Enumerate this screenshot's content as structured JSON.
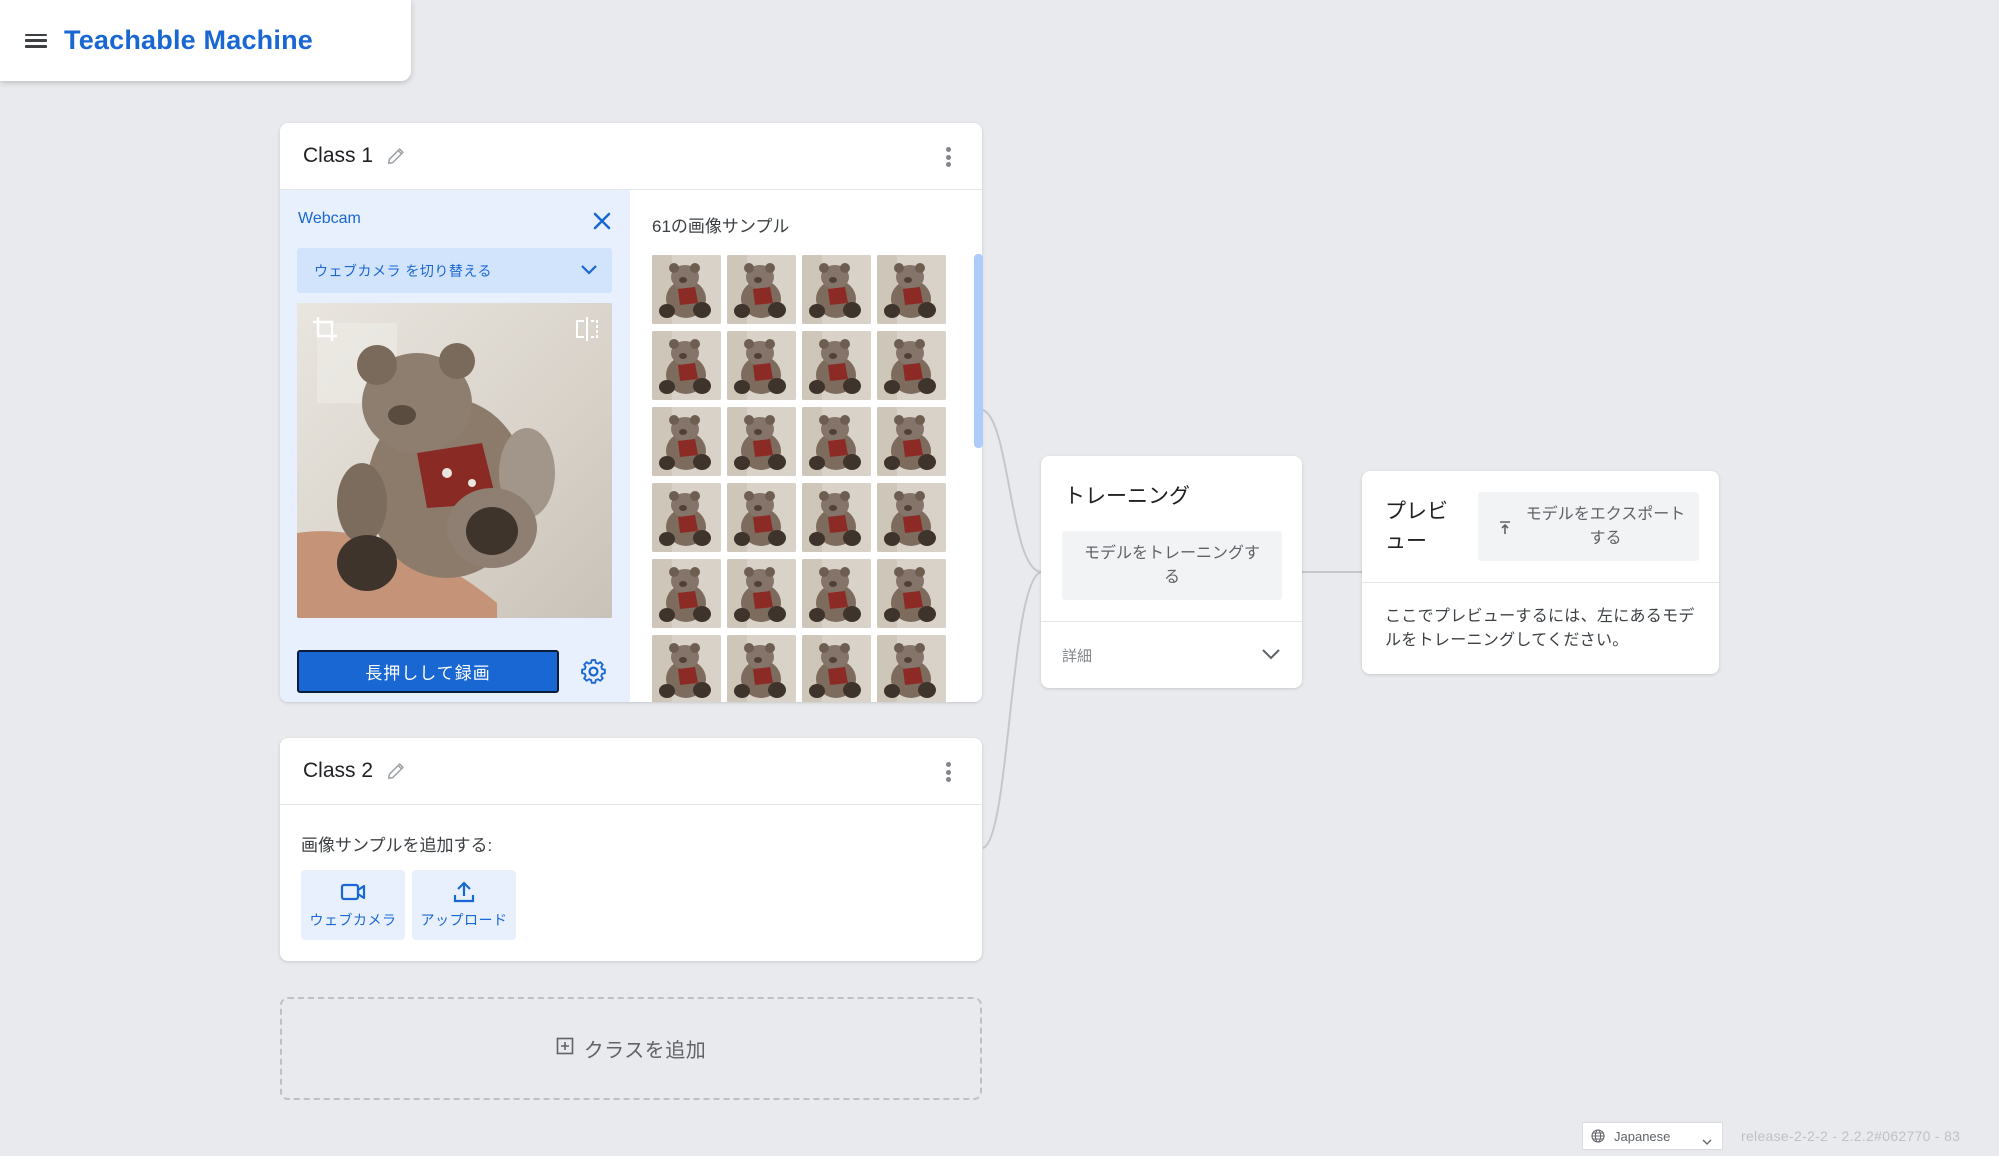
{
  "app": {
    "title": "Teachable Machine"
  },
  "class1": {
    "title": "Class 1",
    "webcam_label": "Webcam",
    "switch_webcam_label": "ウェブカメラ を切り替える",
    "record_label": "長押しして録画",
    "samples_count_label": "61の画像サンプル",
    "visible_thumbnails": 24
  },
  "class2": {
    "title": "Class 2",
    "add_samples_label": "画像サンプルを追加する:",
    "webcam_button_label": "ウェブカメラ",
    "upload_button_label": "アップロード"
  },
  "add_class": {
    "label": "クラスを追加"
  },
  "training": {
    "title": "トレーニング",
    "train_button_label": "モデルをトレーニングする",
    "details_label": "詳細"
  },
  "preview": {
    "title": "プレビュー",
    "export_button_label": "モデルをエクスポートする",
    "message": "ここでプレビューするには、左にあるモデルをトレーニングしてください。"
  },
  "footer": {
    "language": "Japanese",
    "version": "release-2-2-2 - 2.2.2#062770 - 83"
  },
  "colors": {
    "accent": "#1967d2",
    "background": "#e8eaed",
    "webcam_panel": "#e8f0fe",
    "dropdown": "#d2e3fc",
    "scrollbar": "#aecbfa"
  },
  "icons": [
    "menu-icon",
    "pencil-icon",
    "more-vert-icon",
    "close-icon",
    "chevron-down-icon",
    "crop-icon",
    "flip-icon",
    "gear-icon",
    "videocam-icon",
    "upload-icon",
    "add-box-icon",
    "export-icon",
    "globe-icon"
  ]
}
